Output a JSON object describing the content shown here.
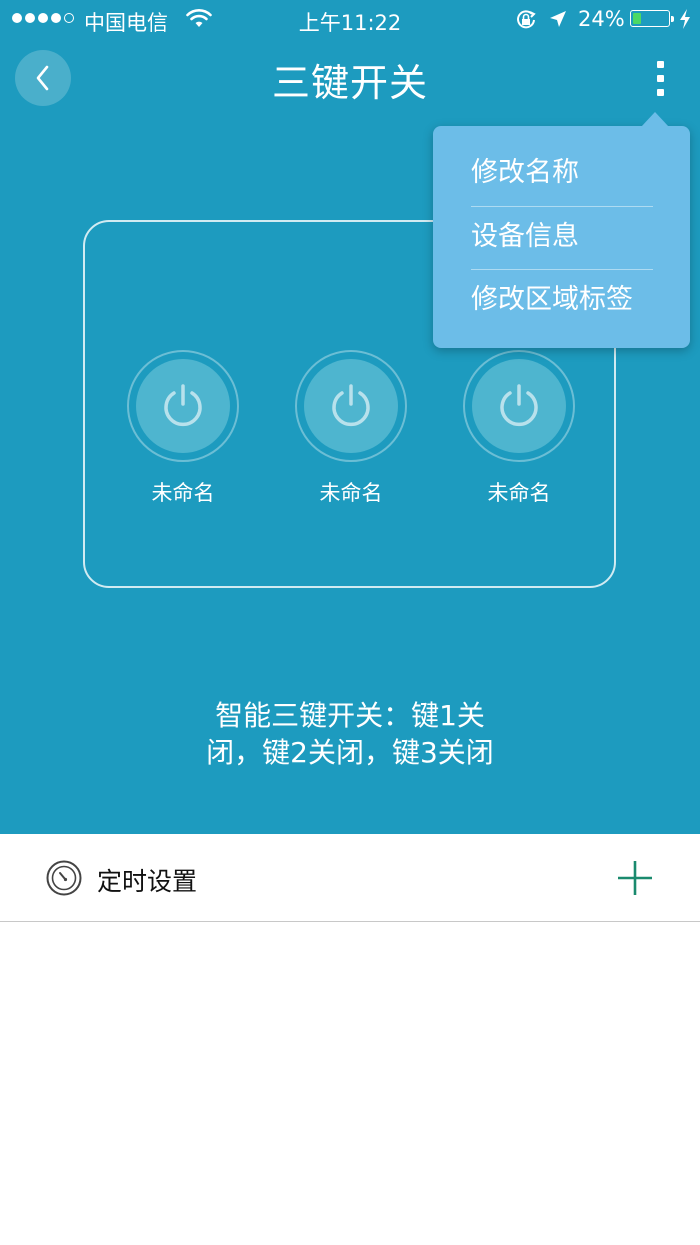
{
  "status_bar": {
    "carrier": "中国电信",
    "time": "上午11:22",
    "battery_percent": "24%",
    "battery_level": 0.24
  },
  "nav": {
    "title": "三键开关"
  },
  "switches": [
    {
      "label": "未命名"
    },
    {
      "label": "未命名"
    },
    {
      "label": "未命名"
    }
  ],
  "status_text": {
    "line1": "智能三键开关：键1关",
    "line2": "闭，键2关闭，键3关闭"
  },
  "menu": {
    "items": [
      {
        "label": "修改名称"
      },
      {
        "label": "设备信息"
      },
      {
        "label": "修改区域标签"
      }
    ]
  },
  "schedule": {
    "label": "定时设置"
  },
  "colors": {
    "primary": "#1d9bbf",
    "menu_bg": "#6cbde8",
    "add_icon": "#1a8a6e",
    "battery_fill": "#4cd964"
  }
}
